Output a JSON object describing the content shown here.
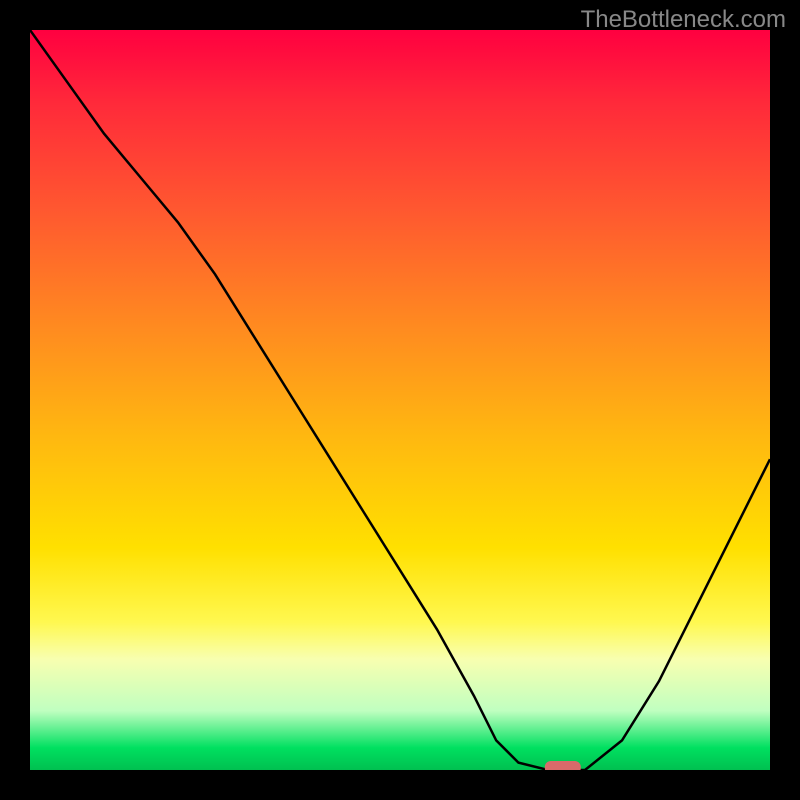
{
  "watermark": "TheBottleneck.com",
  "chart_data": {
    "type": "line",
    "title": "",
    "xlabel": "",
    "ylabel": "",
    "xlim": [
      0,
      100
    ],
    "ylim": [
      0,
      100
    ],
    "x": [
      0,
      5,
      10,
      15,
      20,
      25,
      30,
      35,
      40,
      45,
      50,
      55,
      60,
      63,
      66,
      70,
      75,
      80,
      85,
      90,
      95,
      100
    ],
    "values": [
      100,
      93,
      86,
      80,
      74,
      67,
      59,
      51,
      43,
      35,
      27,
      19,
      10,
      4,
      1,
      0,
      0,
      4,
      12,
      22,
      32,
      42
    ],
    "marker": {
      "x": 72,
      "y": 0,
      "color": "#d96a6a",
      "shape": "rounded-bar"
    },
    "background": "rainbow-gradient-vertical"
  }
}
